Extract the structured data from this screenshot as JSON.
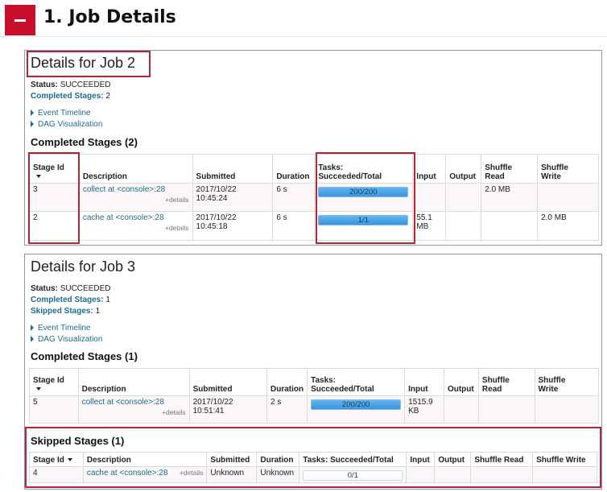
{
  "header": {
    "title": "1. Job Details",
    "icon": "minus-icon",
    "accent_color": "#c8102e"
  },
  "jobs": [
    {
      "title": "Details for Job 2",
      "status_label": "Status:",
      "status_value": "SUCCEEDED",
      "completed_label": "Completed Stages:",
      "completed_value": "2",
      "event_timeline": "Event Timeline",
      "dag_visualization": "DAG Visualization",
      "section_title": "Completed Stages (2)",
      "columns": [
        "Stage Id",
        "Description",
        "Submitted",
        "Duration",
        "Tasks:\nSucceeded/Total",
        "Input",
        "Output",
        "Shuffle\nRead",
        "Shuffle\nWrite"
      ],
      "rows": [
        {
          "stage_id": "3",
          "description": "collect at <console>:28",
          "details": "+details",
          "submitted": "2017/10/22\n10:45:24",
          "duration": "6 s",
          "tasks": "200/200",
          "tasks_progress": 1.0,
          "input": "",
          "output": "",
          "shuffle_read": "2.0 MB",
          "shuffle_write": ""
        },
        {
          "stage_id": "2",
          "description": "cache at <console>:28",
          "details": "+details",
          "submitted": "2017/10/22\n10:45:18",
          "duration": "6 s",
          "tasks": "1/1",
          "tasks_progress": 1.0,
          "input": "55.1\nMB",
          "output": "",
          "shuffle_read": "",
          "shuffle_write": "2.0 MB"
        }
      ]
    },
    {
      "title": "Details for Job 3",
      "status_label": "Status:",
      "status_value": "SUCCEEDED",
      "completed_label": "Completed Stages:",
      "completed_value": "1",
      "skipped_label": "Skipped Stages:",
      "skipped_value": "1",
      "event_timeline": "Event Timeline",
      "dag_visualization": "DAG Visualization",
      "section_title": "Completed Stages (1)",
      "columns": [
        "Stage Id",
        "Description",
        "Submitted",
        "Duration",
        "Tasks:\nSucceeded/Total",
        "Input",
        "Output",
        "Shuffle\nRead",
        "Shuffle\nWrite"
      ],
      "rows": [
        {
          "stage_id": "5",
          "description": "collect at <console>:28",
          "details": "+details",
          "submitted": "2017/10/22\n10:51:41",
          "duration": "2 s",
          "tasks": "200/200",
          "tasks_progress": 1.0,
          "input": "1515.9\nKB",
          "output": "",
          "shuffle_read": "",
          "shuffle_write": ""
        }
      ],
      "skipped_title": "Skipped Stages (1)",
      "skipped_columns": [
        "Stage Id",
        "Description",
        "Submitted",
        "Duration",
        "Tasks: Succeeded/Total",
        "Input",
        "Output",
        "Shuffle Read",
        "Shuffle Write"
      ],
      "skipped_rows": [
        {
          "stage_id": "4",
          "description": "cache at <console>:28",
          "details": "+details",
          "submitted": "Unknown",
          "duration": "Unknown",
          "tasks": "0/1",
          "tasks_progress": 0.0,
          "input": "",
          "output": "",
          "shuffle_read": "",
          "shuffle_write": ""
        }
      ]
    }
  ],
  "colors": {
    "highlight": "#b0243c",
    "link": "#1f6b8c",
    "progress": "#3a95dd"
  }
}
